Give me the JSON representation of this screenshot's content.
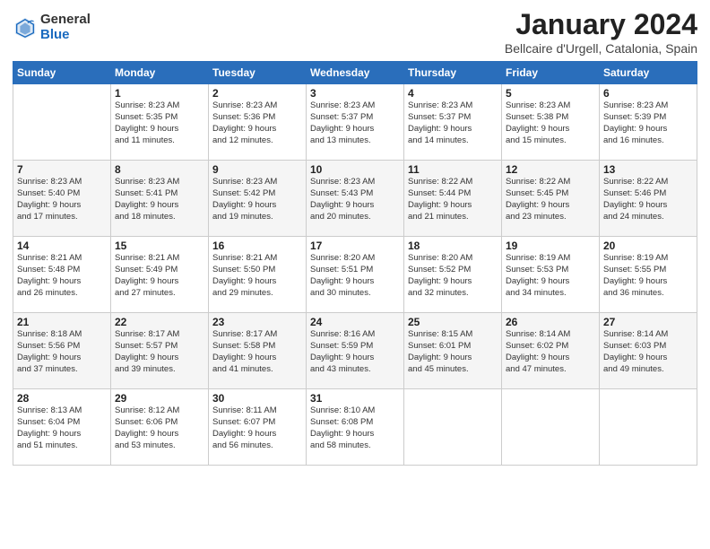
{
  "logo": {
    "general": "General",
    "blue": "Blue"
  },
  "title": "January 2024",
  "location": "Bellcaire d'Urgell, Catalonia, Spain",
  "days_header": [
    "Sunday",
    "Monday",
    "Tuesday",
    "Wednesday",
    "Thursday",
    "Friday",
    "Saturday"
  ],
  "weeks": [
    [
      {
        "day": "",
        "info": ""
      },
      {
        "day": "1",
        "info": "Sunrise: 8:23 AM\nSunset: 5:35 PM\nDaylight: 9 hours\nand 11 minutes."
      },
      {
        "day": "2",
        "info": "Sunrise: 8:23 AM\nSunset: 5:36 PM\nDaylight: 9 hours\nand 12 minutes."
      },
      {
        "day": "3",
        "info": "Sunrise: 8:23 AM\nSunset: 5:37 PM\nDaylight: 9 hours\nand 13 minutes."
      },
      {
        "day": "4",
        "info": "Sunrise: 8:23 AM\nSunset: 5:37 PM\nDaylight: 9 hours\nand 14 minutes."
      },
      {
        "day": "5",
        "info": "Sunrise: 8:23 AM\nSunset: 5:38 PM\nDaylight: 9 hours\nand 15 minutes."
      },
      {
        "day": "6",
        "info": "Sunrise: 8:23 AM\nSunset: 5:39 PM\nDaylight: 9 hours\nand 16 minutes."
      }
    ],
    [
      {
        "day": "7",
        "info": "Sunrise: 8:23 AM\nSunset: 5:40 PM\nDaylight: 9 hours\nand 17 minutes."
      },
      {
        "day": "8",
        "info": "Sunrise: 8:23 AM\nSunset: 5:41 PM\nDaylight: 9 hours\nand 18 minutes."
      },
      {
        "day": "9",
        "info": "Sunrise: 8:23 AM\nSunset: 5:42 PM\nDaylight: 9 hours\nand 19 minutes."
      },
      {
        "day": "10",
        "info": "Sunrise: 8:23 AM\nSunset: 5:43 PM\nDaylight: 9 hours\nand 20 minutes."
      },
      {
        "day": "11",
        "info": "Sunrise: 8:22 AM\nSunset: 5:44 PM\nDaylight: 9 hours\nand 21 minutes."
      },
      {
        "day": "12",
        "info": "Sunrise: 8:22 AM\nSunset: 5:45 PM\nDaylight: 9 hours\nand 23 minutes."
      },
      {
        "day": "13",
        "info": "Sunrise: 8:22 AM\nSunset: 5:46 PM\nDaylight: 9 hours\nand 24 minutes."
      }
    ],
    [
      {
        "day": "14",
        "info": "Sunrise: 8:21 AM\nSunset: 5:48 PM\nDaylight: 9 hours\nand 26 minutes."
      },
      {
        "day": "15",
        "info": "Sunrise: 8:21 AM\nSunset: 5:49 PM\nDaylight: 9 hours\nand 27 minutes."
      },
      {
        "day": "16",
        "info": "Sunrise: 8:21 AM\nSunset: 5:50 PM\nDaylight: 9 hours\nand 29 minutes."
      },
      {
        "day": "17",
        "info": "Sunrise: 8:20 AM\nSunset: 5:51 PM\nDaylight: 9 hours\nand 30 minutes."
      },
      {
        "day": "18",
        "info": "Sunrise: 8:20 AM\nSunset: 5:52 PM\nDaylight: 9 hours\nand 32 minutes."
      },
      {
        "day": "19",
        "info": "Sunrise: 8:19 AM\nSunset: 5:53 PM\nDaylight: 9 hours\nand 34 minutes."
      },
      {
        "day": "20",
        "info": "Sunrise: 8:19 AM\nSunset: 5:55 PM\nDaylight: 9 hours\nand 36 minutes."
      }
    ],
    [
      {
        "day": "21",
        "info": "Sunrise: 8:18 AM\nSunset: 5:56 PM\nDaylight: 9 hours\nand 37 minutes."
      },
      {
        "day": "22",
        "info": "Sunrise: 8:17 AM\nSunset: 5:57 PM\nDaylight: 9 hours\nand 39 minutes."
      },
      {
        "day": "23",
        "info": "Sunrise: 8:17 AM\nSunset: 5:58 PM\nDaylight: 9 hours\nand 41 minutes."
      },
      {
        "day": "24",
        "info": "Sunrise: 8:16 AM\nSunset: 5:59 PM\nDaylight: 9 hours\nand 43 minutes."
      },
      {
        "day": "25",
        "info": "Sunrise: 8:15 AM\nSunset: 6:01 PM\nDaylight: 9 hours\nand 45 minutes."
      },
      {
        "day": "26",
        "info": "Sunrise: 8:14 AM\nSunset: 6:02 PM\nDaylight: 9 hours\nand 47 minutes."
      },
      {
        "day": "27",
        "info": "Sunrise: 8:14 AM\nSunset: 6:03 PM\nDaylight: 9 hours\nand 49 minutes."
      }
    ],
    [
      {
        "day": "28",
        "info": "Sunrise: 8:13 AM\nSunset: 6:04 PM\nDaylight: 9 hours\nand 51 minutes."
      },
      {
        "day": "29",
        "info": "Sunrise: 8:12 AM\nSunset: 6:06 PM\nDaylight: 9 hours\nand 53 minutes."
      },
      {
        "day": "30",
        "info": "Sunrise: 8:11 AM\nSunset: 6:07 PM\nDaylight: 9 hours\nand 56 minutes."
      },
      {
        "day": "31",
        "info": "Sunrise: 8:10 AM\nSunset: 6:08 PM\nDaylight: 9 hours\nand 58 minutes."
      },
      {
        "day": "",
        "info": ""
      },
      {
        "day": "",
        "info": ""
      },
      {
        "day": "",
        "info": ""
      }
    ]
  ]
}
